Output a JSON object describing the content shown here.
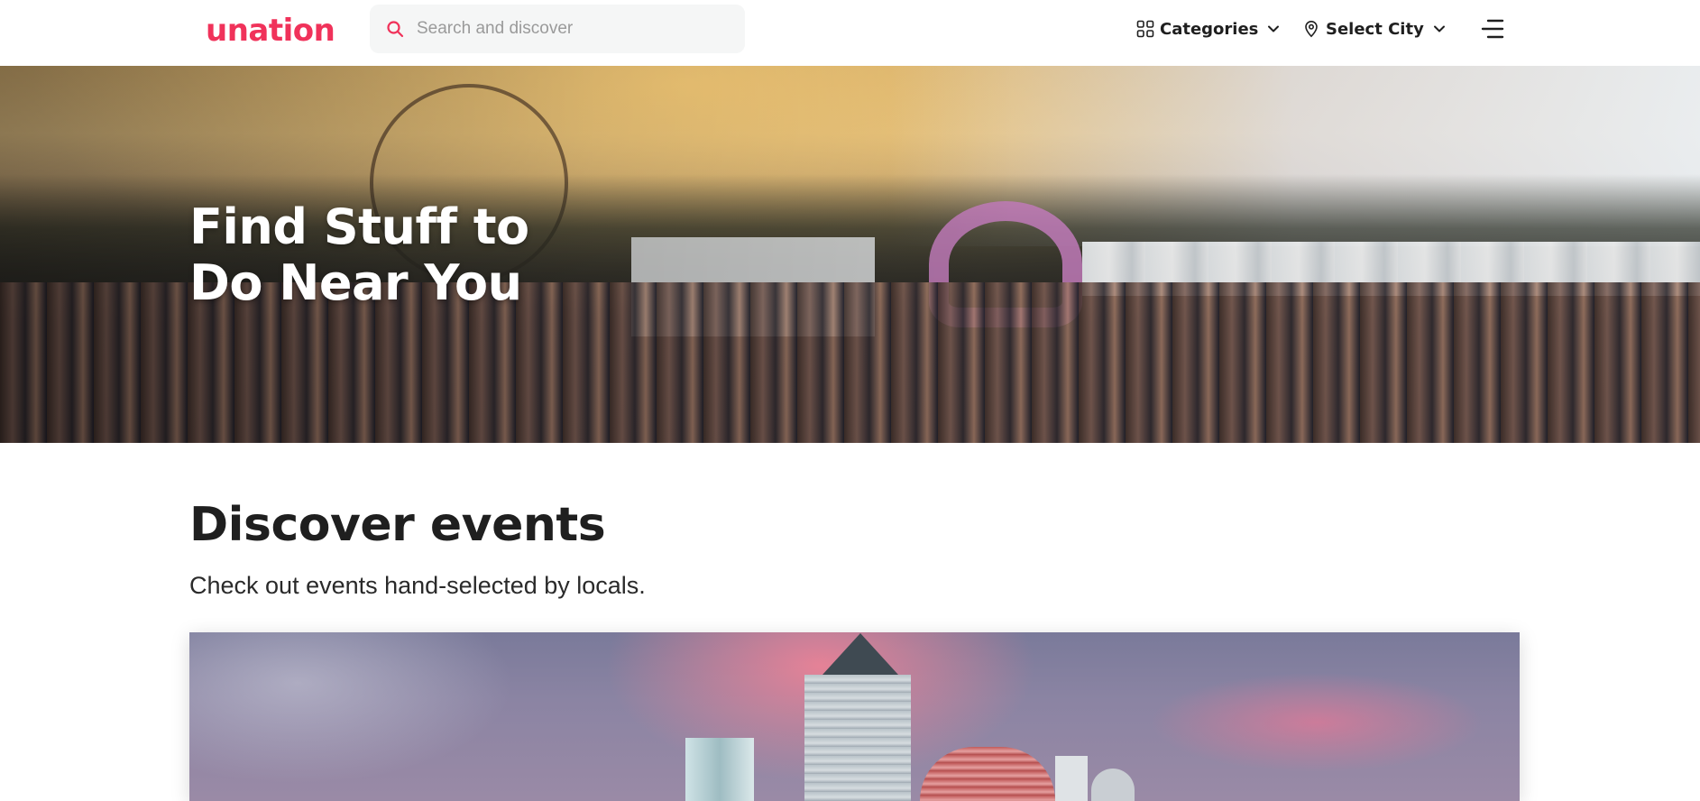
{
  "header": {
    "logo": "unation",
    "search": {
      "placeholder": "Search and discover"
    },
    "categories_label": "Categories",
    "city_label": "Select City"
  },
  "hero": {
    "title": "Find Stuff to Do Near You"
  },
  "discover": {
    "title": "Discover events",
    "subtitle": "Check out events hand-selected by locals."
  },
  "colors": {
    "brand": "#f0325a",
    "text": "#1f1f1f",
    "search_bg": "#f5f6f6"
  },
  "icons": {
    "search": "search-icon",
    "categories": "grid-icon",
    "city": "map-pin-icon",
    "chevron": "chevron-down-icon",
    "menu": "menu-icon"
  }
}
